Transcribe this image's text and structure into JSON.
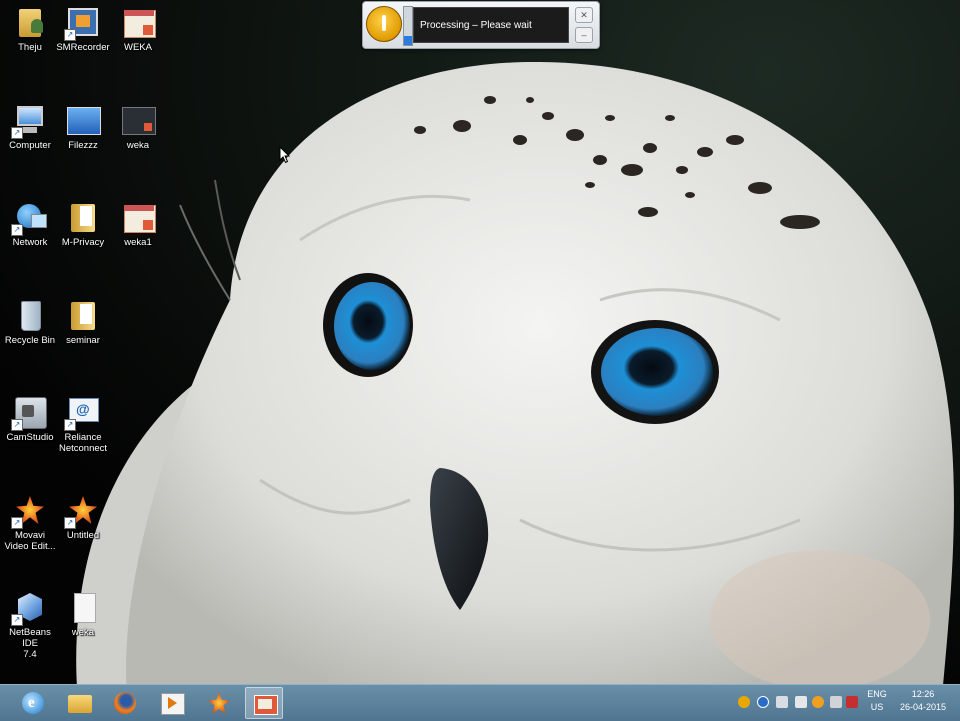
{
  "desktop": {
    "icons": [
      {
        "label": "Theju",
        "icon": "user-folder-icon"
      },
      {
        "label": "SMRecorder",
        "icon": "film-app-icon"
      },
      {
        "label": "WEKA",
        "icon": "weka-document-icon"
      },
      {
        "label": "Computer",
        "icon": "computer-icon"
      },
      {
        "label": "Filezzz",
        "icon": "blue-screen-icon"
      },
      {
        "label": "weka",
        "icon": "weka-dark-icon"
      },
      {
        "label": "Network",
        "icon": "network-globe-icon"
      },
      {
        "label": "M-Privacy",
        "icon": "folder-icon"
      },
      {
        "label": "weka1",
        "icon": "weka-document-icon"
      },
      {
        "label": "Recycle Bin",
        "icon": "recycle-bin-icon"
      },
      {
        "label": "seminar",
        "icon": "folder-icon"
      },
      {
        "label": "CamStudio",
        "icon": "camera-app-icon"
      },
      {
        "label": "Reliance\nNetconnect",
        "icon": "reliance-net-icon"
      },
      {
        "label": "Movavi\nVideo Edit...",
        "icon": "movavi-star-icon"
      },
      {
        "label": "Untitled",
        "icon": "movavi-star-icon"
      },
      {
        "label": "NetBeans IDE\n7.4",
        "icon": "netbeans-cube-icon"
      },
      {
        "label": "weka",
        "icon": "text-file-icon"
      }
    ]
  },
  "dialog": {
    "message": "Processing – Please wait",
    "progress": 0.25,
    "close_glyph": "✕",
    "minimize_glyph": "–"
  },
  "taskbar": {
    "pinned": [
      {
        "icon": "internet-explorer-icon",
        "active": false
      },
      {
        "icon": "file-explorer-icon",
        "active": false
      },
      {
        "icon": "firefox-icon",
        "active": false
      },
      {
        "icon": "media-player-icon",
        "active": false
      },
      {
        "icon": "movavi-icon",
        "active": false
      },
      {
        "icon": "recorder-app-icon",
        "active": true
      }
    ],
    "tray": {
      "lang_top": "ENG",
      "lang_bottom": "US",
      "time": "12:26",
      "date": "26-04-2015"
    }
  },
  "colors": {
    "taskbar": "#5b819b",
    "dialog_text_bg": "#1b1b1b",
    "owl_eye": "#1e8fd6"
  }
}
